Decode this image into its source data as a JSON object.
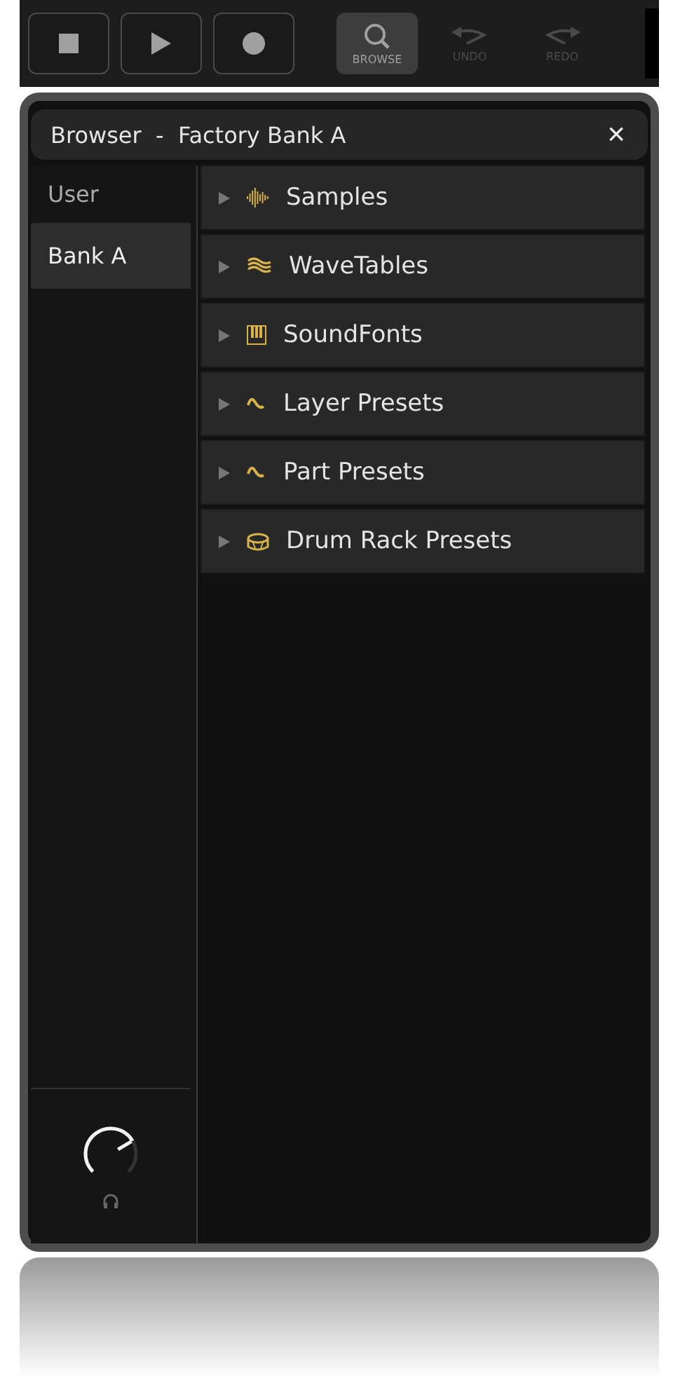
{
  "toolbar": [
    {
      "kind": "stop",
      "selected": false,
      "disabled": false
    },
    {
      "kind": "play",
      "selected": false,
      "disabled": false
    },
    {
      "kind": "record",
      "selected": false,
      "disabled": false
    },
    {
      "kind": "browse",
      "label": "BROWSE",
      "selected": true,
      "disabled": false
    },
    {
      "kind": "undo",
      "label": "UNDO",
      "selected": false,
      "disabled": true
    },
    {
      "kind": "redo",
      "label": "REDO",
      "selected": false,
      "disabled": true
    }
  ],
  "browser": {
    "title": "Browser  -  Factory Bank A",
    "close": "×"
  },
  "sidebar": {
    "items": [
      {
        "label": "User",
        "selected": false
      },
      {
        "label": "Bank A",
        "selected": true
      }
    ],
    "knob": {
      "level": 0.72
    }
  },
  "categories": [
    {
      "kind": "samples",
      "label": "Samples",
      "expanded": false
    },
    {
      "kind": "wavetables",
      "label": "WaveTables",
      "expanded": false
    },
    {
      "kind": "soundfonts",
      "label": "SoundFonts",
      "expanded": false
    },
    {
      "kind": "wave",
      "label": "Layer Presets",
      "expanded": false
    },
    {
      "kind": "wave",
      "label": "Part Presets",
      "expanded": false
    },
    {
      "kind": "drum",
      "label": "Drum Rack Presets",
      "expanded": false
    }
  ]
}
